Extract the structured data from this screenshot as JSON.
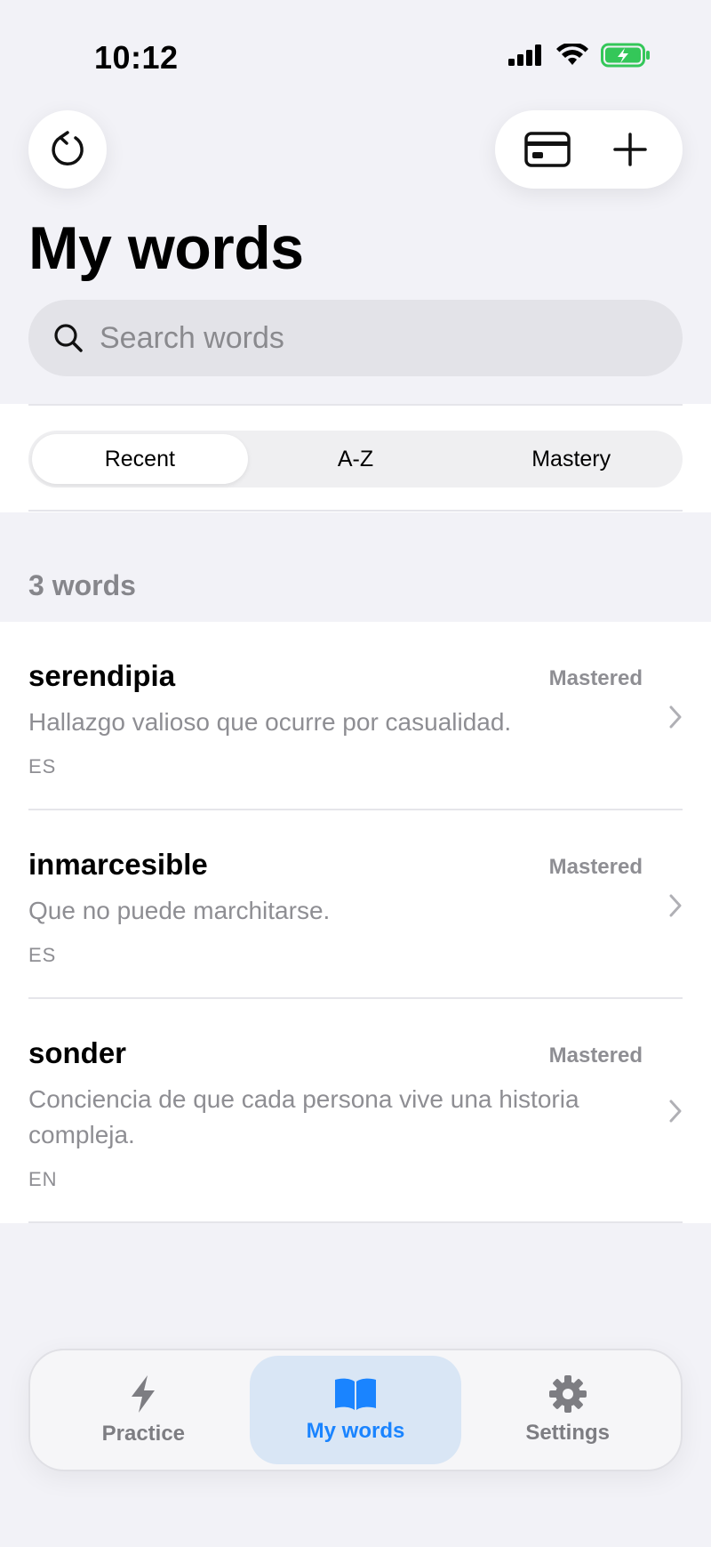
{
  "status_bar": {
    "time": "10:12"
  },
  "header": {
    "title": "My words",
    "refresh_icon": "refresh-icon",
    "card_icon": "credit-card-icon",
    "add_icon": "plus-icon"
  },
  "search": {
    "placeholder": "Search words",
    "value": ""
  },
  "sort": {
    "options": [
      "Recent",
      "A-Z",
      "Mastery"
    ],
    "selected": "Recent"
  },
  "list": {
    "count_label": "3 words",
    "items": [
      {
        "term": "serendipia",
        "status": "Mastered",
        "definition": "Hallazgo valioso que ocurre por casualidad.",
        "lang": "ES"
      },
      {
        "term": "inmarcesible",
        "status": "Mastered",
        "definition": "Que no puede marchitarse.",
        "lang": "ES"
      },
      {
        "term": "sonder",
        "status": "Mastered",
        "definition": "Conciencia de que cada persona vive una historia compleja.",
        "lang": "EN"
      }
    ]
  },
  "tabs": [
    {
      "label": "Practice",
      "icon": "bolt-icon"
    },
    {
      "label": "My words",
      "icon": "book-icon"
    },
    {
      "label": "Settings",
      "icon": "gear-icon"
    }
  ],
  "colors": {
    "accent": "#1a84ff",
    "battery": "#34c759"
  }
}
